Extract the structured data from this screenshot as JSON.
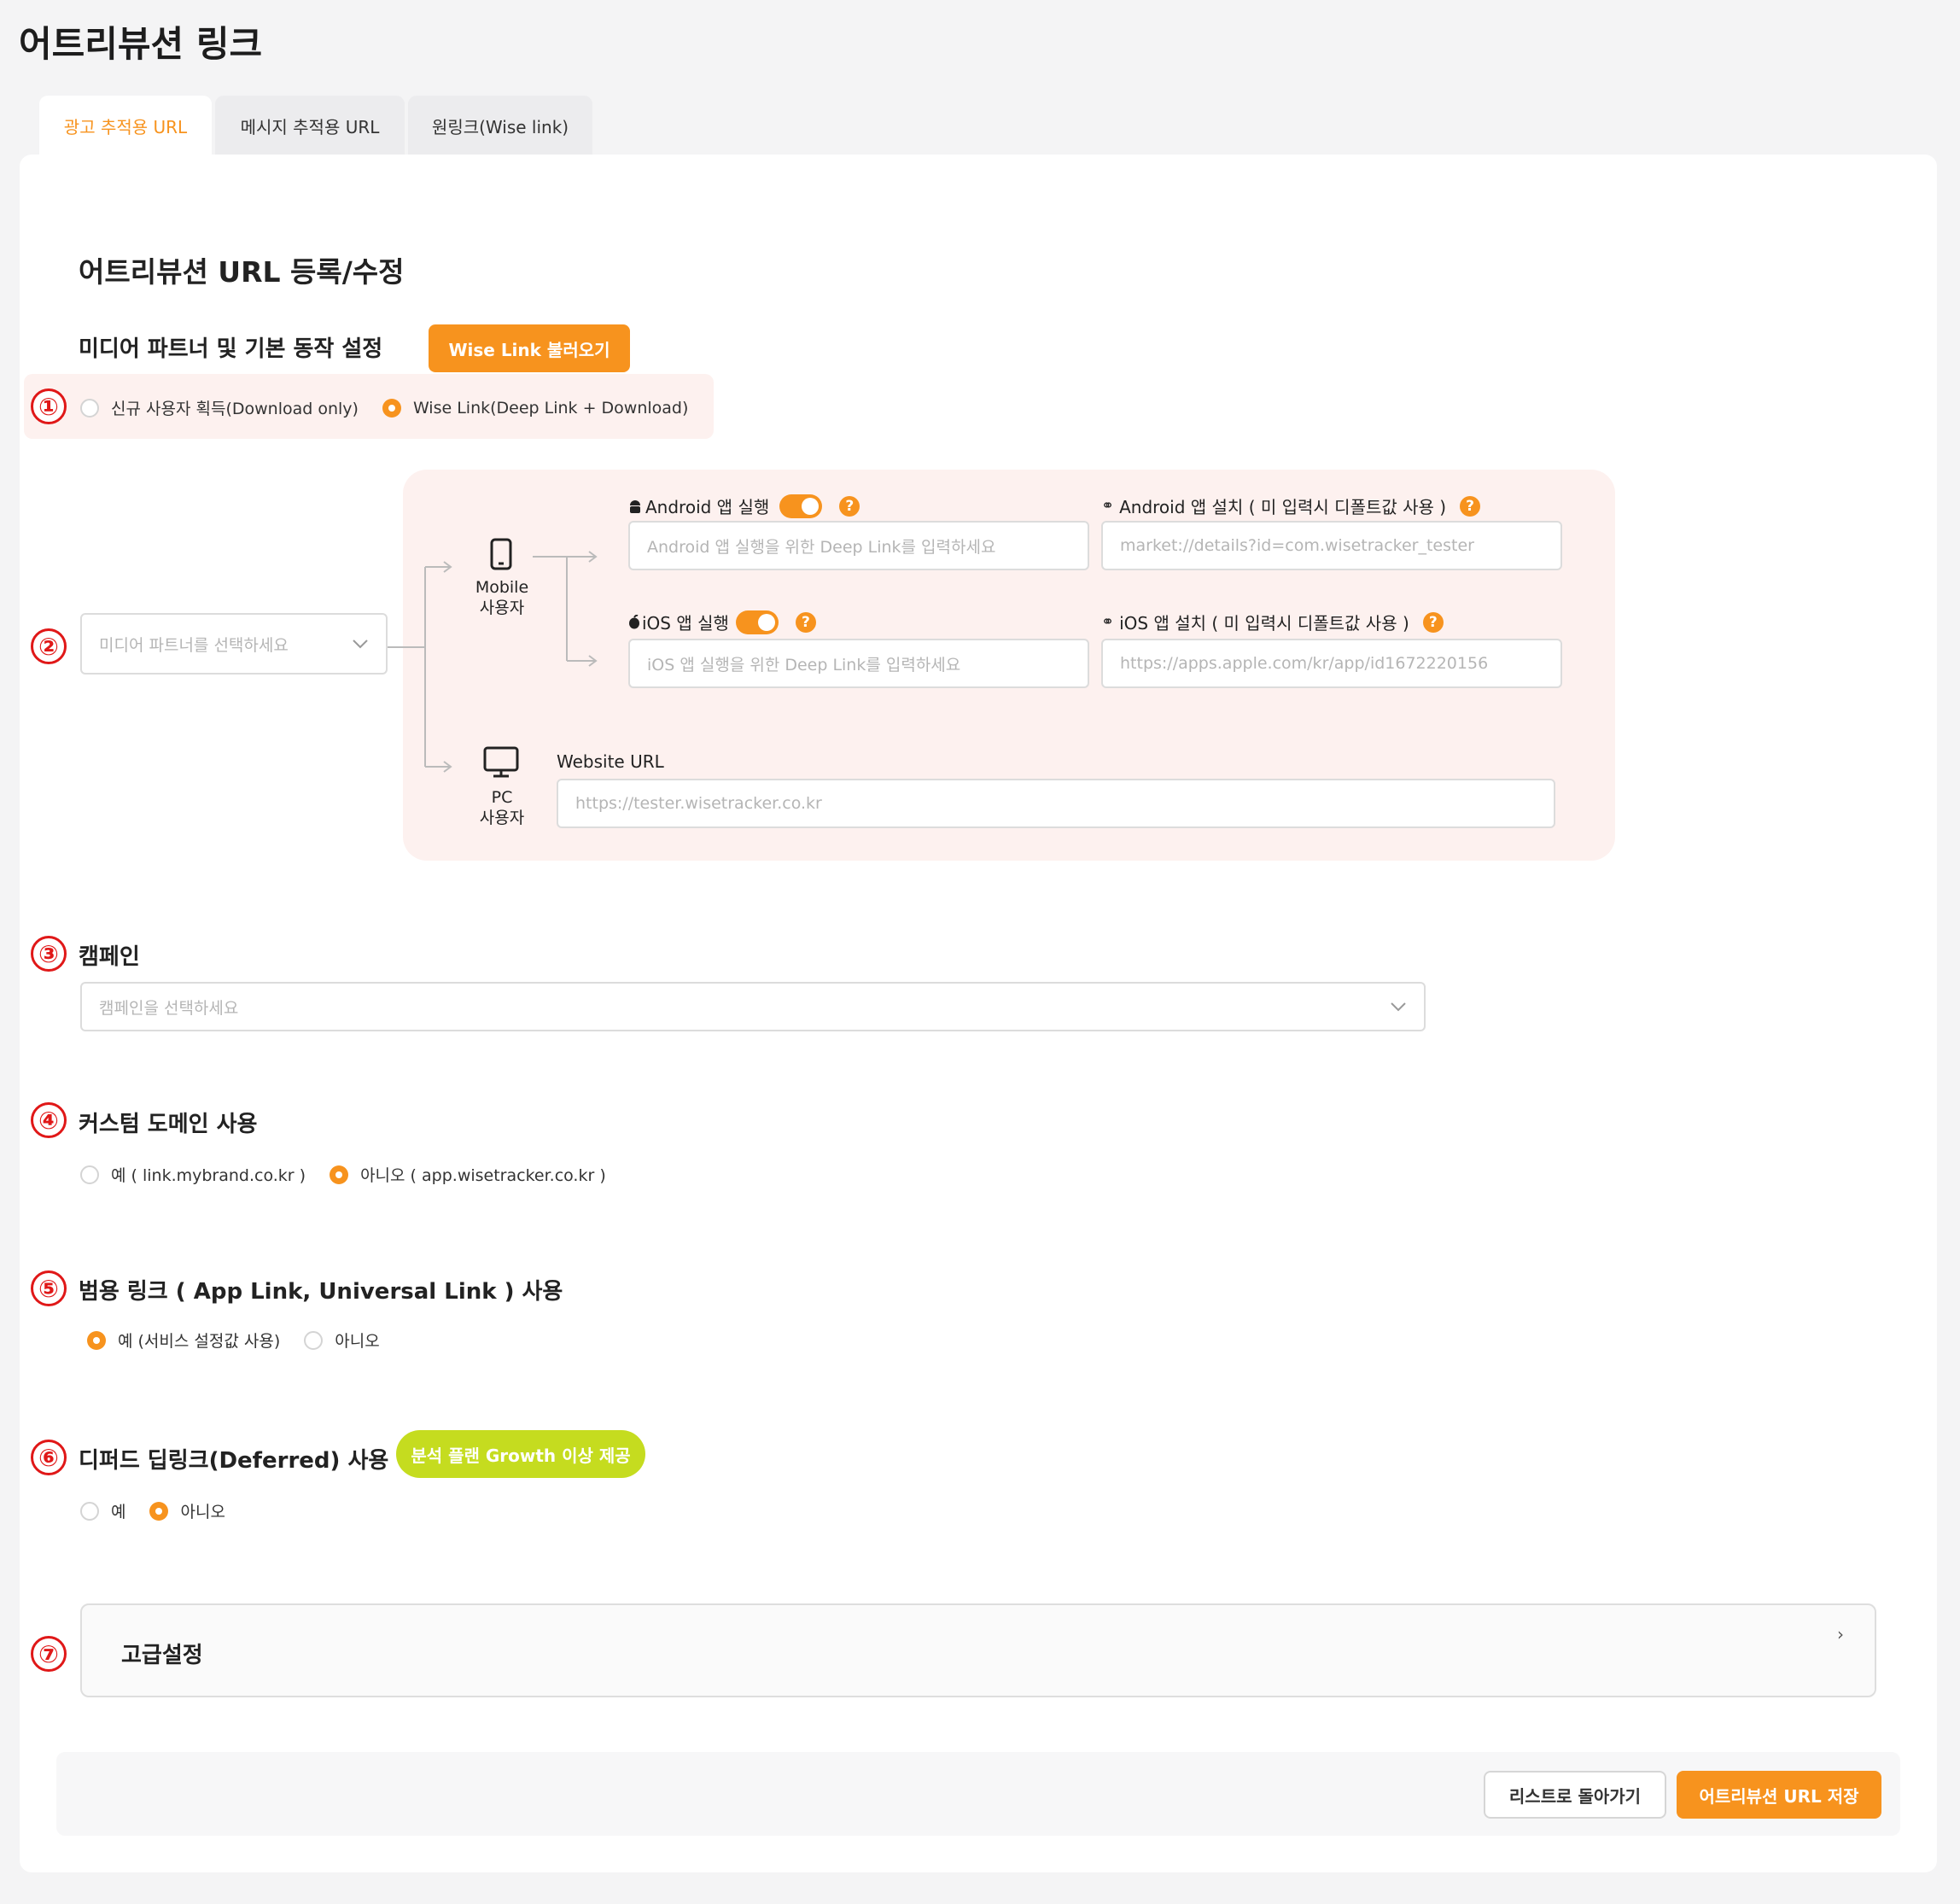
{
  "page_title": "어트리뷰션 링크",
  "tabs": [
    {
      "label": "광고 추적용 URL",
      "active": true
    },
    {
      "label": "메시지 추적용 URL",
      "active": false
    },
    {
      "label": "원링크(Wise link)",
      "active": false
    }
  ],
  "form": {
    "title": "어트리뷰션 URL 등록/수정",
    "media_section": {
      "title": "미디어 파트너 및 기본 동작 설정",
      "load_button": "Wise Link 불러오기",
      "options": [
        "신규 사용자 획득(Download only)",
        "Wise Link(Deep Link + Download)"
      ],
      "selected": 1
    },
    "media_partner_select": {
      "placeholder": "미디어 파트너를 선택하세요"
    },
    "mobile": {
      "label_line1": "Mobile",
      "label_line2": "사용자",
      "android_exec": {
        "label": "Android 앱 실행",
        "placeholder": "Android 앱 실행을 위한 Deep Link를 입력하세요"
      },
      "android_install": {
        "label": "Android 앱 설치 ( 미 입력시 디폴트값 사용 )",
        "placeholder": "market://details?id=com.wisetracker_tester"
      },
      "ios_exec": {
        "label": "iOS 앱 실행",
        "placeholder": "iOS 앱 실행을 위한 Deep Link를 입력하세요"
      },
      "ios_install": {
        "label": "iOS 앱 설치 ( 미 입력시 디폴트값 사용 )",
        "placeholder": "https://apps.apple.com/kr/app/id1672220156"
      }
    },
    "pc": {
      "label_line1": "PC",
      "label_line2": "사용자",
      "website_label": "Website URL",
      "website_placeholder": "https://tester.wisetracker.co.kr"
    },
    "campaign": {
      "title": "캠페인",
      "placeholder": "캠페인을 선택하세요"
    },
    "custom_domain": {
      "title": "커스텀 도메인 사용",
      "options": [
        "예 ( link.mybrand.co.kr )",
        "아니오 ( app.wisetracker.co.kr )"
      ],
      "selected": 1
    },
    "universal_link": {
      "title": "범용 링크 ( App Link, Universal Link ) 사용",
      "options": [
        "예 (서비스 설정값 사용)",
        "아니오"
      ],
      "selected": 0
    },
    "deferred": {
      "title": "디퍼드 딥링크(Deferred) 사용",
      "badge": "분석 플랜 Growth 이상 제공",
      "options": [
        "예",
        "아니오"
      ],
      "selected": 1
    },
    "advanced": {
      "title": "고급설정"
    }
  },
  "numbers": [
    "①",
    "②",
    "③",
    "④",
    "⑤",
    "⑥",
    "⑦"
  ],
  "footer": {
    "back_button": "리스트로 돌아가기",
    "save_button": "어트리뷰션 URL 저장"
  },
  "colors": {
    "accent": "#f7931e",
    "marker": "#e01818",
    "badge": "#c5dc1f",
    "panel": "#fdf1ef"
  }
}
